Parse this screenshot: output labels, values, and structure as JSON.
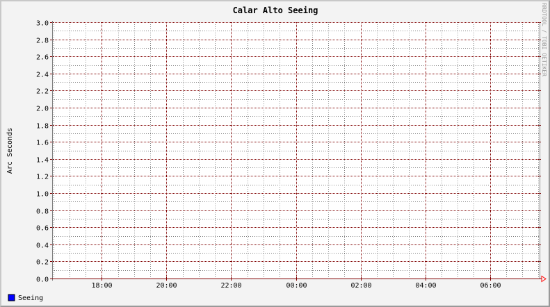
{
  "chart_data": {
    "type": "line",
    "title": "Calar Alto Seeing",
    "xlabel": "",
    "ylabel": "Arc Seconds",
    "ylim": [
      0,
      3.0
    ],
    "yticks": [
      "0.0",
      "0.2",
      "0.4",
      "0.6",
      "0.8",
      "1.0",
      "1.2",
      "1.4",
      "1.6",
      "1.8",
      "2.0",
      "2.2",
      "2.4",
      "2.6",
      "2.8",
      "3.0"
    ],
    "xlim": [
      "16:28",
      "07:32"
    ],
    "xticks": [
      "18:00",
      "20:00",
      "22:00",
      "00:00",
      "02:00",
      "04:00",
      "06:00"
    ],
    "grid": true,
    "series": [
      {
        "name": "Seeing",
        "color": "#0000ff",
        "values": []
      }
    ],
    "legend": "bottom-left",
    "watermark": "RRDTOOL / TOBI OETIKER",
    "colors": {
      "background": "#f3f3f3",
      "plot": "#ffffff",
      "major_grid": "#800000",
      "minor_grid": "#808080",
      "axis": "#808080",
      "arrow": "#ff0000"
    }
  }
}
